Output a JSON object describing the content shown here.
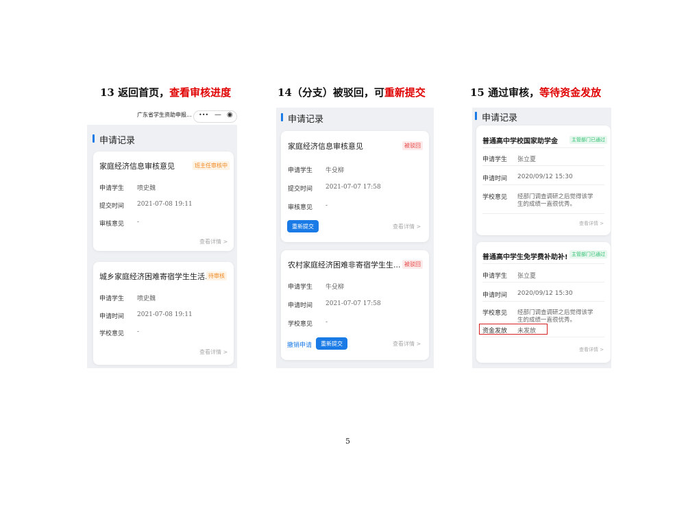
{
  "headings": [
    {
      "num": "13 ",
      "plain": "返回首页，",
      "red": "查看审核进度"
    },
    {
      "num": "14",
      "plain": "（分支）被驳回，可",
      "red": "重新提交"
    },
    {
      "num": "15 ",
      "plain": "通过审核，",
      "red": "等待资金发放"
    }
  ],
  "screen1": {
    "top_title": "广东省学生资助申报...",
    "section": "申请记录",
    "card1": {
      "title": "家庭经济信息审核意见",
      "badge": "班主任审核中",
      "rows": [
        {
          "label": "申请学生",
          "value": "喷史魏"
        },
        {
          "label": "提交时间",
          "value": "2021-07-08 19:11"
        },
        {
          "label": "审核意见",
          "value": "-"
        }
      ],
      "link": "查看详情 >"
    },
    "card2": {
      "title": "城乡家庭经济困难寄宿学生生活...",
      "badge": "待审核",
      "rows": [
        {
          "label": "申请学生",
          "value": "喷史魏"
        },
        {
          "label": "申请时间",
          "value": "2021-07-08 19:11"
        },
        {
          "label": "学校意见",
          "value": "-"
        }
      ],
      "link": "查看详情 >"
    }
  },
  "screen2": {
    "section": "申请记录",
    "card1": {
      "title": "家庭经济信息审核意见",
      "badge": "被驳回",
      "rows": [
        {
          "label": "申请学生",
          "value": "牛殳柳"
        },
        {
          "label": "提交时间",
          "value": "2021-07-07 17:58"
        },
        {
          "label": "审核意见",
          "value": "-"
        }
      ],
      "button": "重新提交",
      "link": "查看详情 >"
    },
    "card2": {
      "title": "农村家庭经济困难非寄宿学生生...",
      "badge": "被驳回",
      "rows": [
        {
          "label": "申请学生",
          "value": "牛殳柳"
        },
        {
          "label": "申请时间",
          "value": "2021-07-07 17:58"
        },
        {
          "label": "学校意见",
          "value": "-"
        }
      ],
      "cancel": "撤销申请",
      "button": "重新提交",
      "link": "查看详情 >"
    }
  },
  "screen3": {
    "section": "申请记录",
    "card1": {
      "title": "普通高中学校国家助学金",
      "badge": "主管部门已通过",
      "rows": [
        {
          "label": "申请学生",
          "value": "张立夏"
        },
        {
          "label": "申请时间",
          "value": "2020/09/12  15:30"
        },
        {
          "label": "学校意见",
          "value": "经部门调查调研之后觉得该学",
          "value2": "生的成绩一直很优秀。"
        }
      ],
      "link": "查看详情 >"
    },
    "card2": {
      "title": "普通高中学生免学费补助补!",
      "badge": "主管部门已通过",
      "rows": [
        {
          "label": "申请学生",
          "value": "张立夏"
        },
        {
          "label": "申请时间",
          "value": "2020/09/12  15:30"
        },
        {
          "label": "学校意见",
          "value": "经部门调查调研之后觉得该学",
          "value2": "生的成绩一直很优秀。"
        },
        {
          "label": "资金发放",
          "value": "未发放"
        }
      ],
      "link": "查看详情 >"
    }
  },
  "page_number": "5",
  "colors": {
    "accent": "#1b7be6",
    "highlight": "#e00000",
    "badge_orange": "#f08a24",
    "badge_red": "#e64545",
    "badge_green": "#2fbf71"
  }
}
